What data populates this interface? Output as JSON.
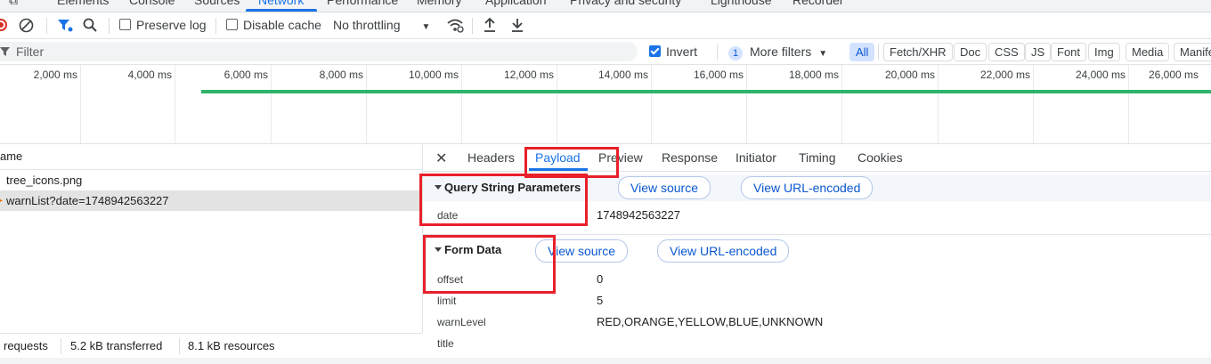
{
  "top_tabs": [
    "Elements",
    "Console",
    "Sources",
    "Network",
    "Performance",
    "Memory",
    "Application",
    "Privacy and security",
    "Lighthouse",
    "Recorder"
  ],
  "toolbar": {
    "preserve_log": "Preserve log",
    "disable_cache": "Disable cache",
    "throttling": "No throttling"
  },
  "filter": {
    "placeholder": "Filter",
    "invert": "Invert",
    "more_filters_count": "1",
    "more_filters": "More filters",
    "types": [
      "All",
      "Fetch/XHR",
      "Doc",
      "CSS",
      "JS",
      "Font",
      "Img",
      "Media",
      "Manife"
    ]
  },
  "timeline": {
    "ticks": [
      "2,000 ms",
      "4,000 ms",
      "6,000 ms",
      "8,000 ms",
      "10,000 ms",
      "12,000 ms",
      "14,000 ms",
      "16,000 ms",
      "18,000 ms",
      "20,000 ms",
      "22,000 ms",
      "24,000 ms",
      "26,000 ms"
    ]
  },
  "list": {
    "header": "ame",
    "rows": [
      "tree_icons.png",
      "warnList?date=1748942563227"
    ]
  },
  "status": {
    "requests": "requests",
    "transferred": "5.2 kB transferred",
    "resources": "8.1 kB resources"
  },
  "details": {
    "tabs": [
      "Headers",
      "Payload",
      "Preview",
      "Response",
      "Initiator",
      "Timing",
      "Cookies"
    ],
    "query": {
      "title": "Query String Parameters",
      "view_source": "View source",
      "view_url_encoded": "View URL-encoded",
      "params": [
        {
          "key": "date",
          "value": "1748942563227"
        }
      ]
    },
    "form": {
      "title": "Form Data",
      "view_source": "View source",
      "view_url_encoded": "View URL-encoded",
      "params": [
        {
          "key": "offset",
          "value": "0"
        },
        {
          "key": "limit",
          "value": "5"
        },
        {
          "key": "warnLevel",
          "value": "RED,ORANGE,YELLOW,BLUE,UNKNOWN"
        },
        {
          "key": "title",
          "value": ""
        }
      ]
    }
  },
  "colors": {
    "accent": "#1a73e8",
    "highlight_box": "#e8202a",
    "timeline_bar": "#2fb36b"
  }
}
